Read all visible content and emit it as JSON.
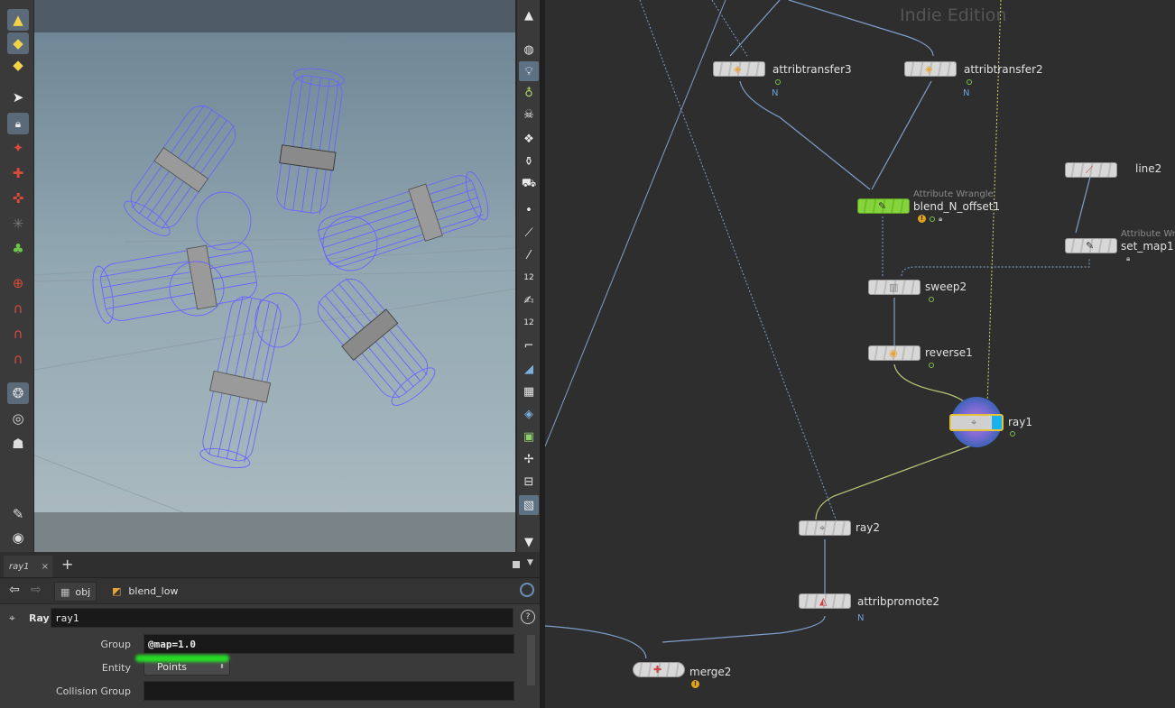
{
  "left_toolbar": {
    "icons": [
      "select-mode-icon",
      "component-mode-icon",
      "object-mode-icon",
      "pointer-icon",
      "lock-icon",
      "view-handle-icon",
      "transform-handle-icon",
      "rotate-handle-icon",
      "scale-handle-icon",
      "pose-icon",
      "snap-grid-icon",
      "snap-prim-icon",
      "snap-point-icon",
      "snap-magnet-icon",
      "render-view-icon",
      "camera-icon",
      "light-icon",
      "tumble-icon",
      "home-icon"
    ]
  },
  "right_toolbar": {
    "icons": [
      "display-options-icon",
      "light-bulb-icon",
      "ghost-icon",
      "skull-icon",
      "wireframe-icon",
      "shaded-icon",
      "texture-icon",
      "point-icon",
      "normal-icon",
      "vertex-icon",
      "number-12-icon",
      "pen-icon",
      "number-12b-icon",
      "curve-icon",
      "snap-icon",
      "checker-icon",
      "layers-icon",
      "background-icon",
      "split-icon",
      "grid-icon",
      "image-icon"
    ]
  },
  "param_pane": {
    "tab_label": "ray1",
    "tab_close": "×",
    "add_tab": "+",
    "crumbs": {
      "obj": "obj",
      "blend_low": "blend_low"
    },
    "node_type": "Ray",
    "node_name": "ray1",
    "help": "?",
    "params": {
      "group_label": "Group",
      "group_value": "@map=1.0",
      "entity_label": "Entity",
      "entity_value": "Points",
      "collision_label": "Collision Group",
      "collision_value": ""
    }
  },
  "network": {
    "watermark": "Indie Edition",
    "nodes": {
      "attribtransfer3": "attribtransfer3",
      "attribtransfer2": "attribtransfer2",
      "blend_N_offset1": "blend_N_offset1",
      "blend_sub": "Attribute Wrangle",
      "line2": "line2",
      "set_map1": "set_map1",
      "set_map1_sub": "Attribute Wra",
      "sweep2": "sweep2",
      "reverse1": "reverse1",
      "ray1": "ray1",
      "ray2": "ray2",
      "attribpromote2": "attribpromote2",
      "merge2": "merge2"
    },
    "flag_n": "N",
    "warn_glyph": "!"
  },
  "colors": {
    "wire": "#7f9fca",
    "wire_green": "#b8c87a",
    "dotted": "#7f9fca",
    "dotted_yellow": "#d9d36a",
    "wrangle_green": "#7fcf3a",
    "selected": "#e6c13a",
    "cylinder": "#7a6cff"
  }
}
